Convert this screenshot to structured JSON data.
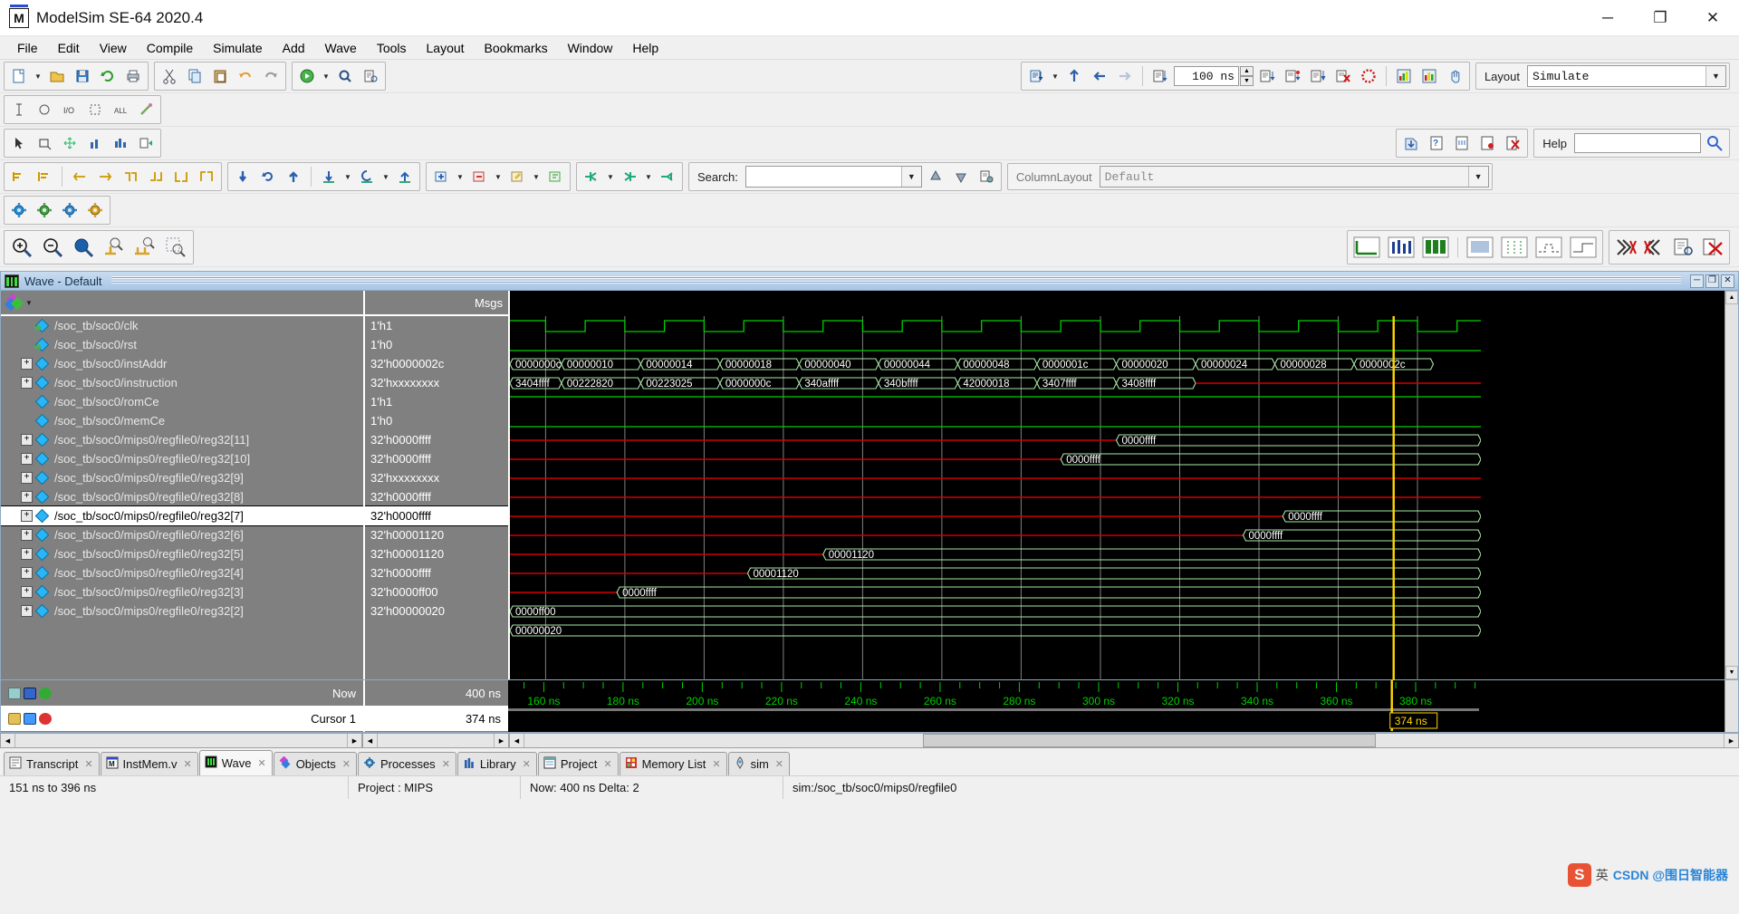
{
  "window": {
    "title": "ModelSim SE-64 2020.4",
    "icon": "modelsim-icon",
    "minimize": "─",
    "maximize": "❐",
    "close": "✕"
  },
  "menu": [
    "File",
    "Edit",
    "View",
    "Compile",
    "Simulate",
    "Add",
    "Wave",
    "Tools",
    "Layout",
    "Bookmarks",
    "Window",
    "Help"
  ],
  "toolbar": {
    "run_length_value": "100 ns",
    "layout_label": "Layout",
    "layout_value": "Simulate",
    "help_label": "Help",
    "help_value": "",
    "search_label": "Search:",
    "search_value": "",
    "search_placeholder": "",
    "columnlayout_label": "ColumnLayout",
    "columnlayout_value": "Default"
  },
  "wave_window": {
    "title": "Wave - Default",
    "minimize": "─",
    "restore": "❐",
    "close": "✕",
    "values_header": "Msgs"
  },
  "signals": [
    {
      "name": "/soc_tb/soc0/clk",
      "value": "1'h1",
      "expandable": false,
      "selected": false,
      "type": "input"
    },
    {
      "name": "/soc_tb/soc0/rst",
      "value": "1'h0",
      "expandable": false,
      "selected": false,
      "type": "input"
    },
    {
      "name": "/soc_tb/soc0/instAddr",
      "value": "32'h0000002c",
      "expandable": true,
      "selected": false,
      "type": "bus"
    },
    {
      "name": "/soc_tb/soc0/instruction",
      "value": "32'hxxxxxxxx",
      "expandable": true,
      "selected": false,
      "type": "bus"
    },
    {
      "name": "/soc_tb/soc0/romCe",
      "value": "1'h1",
      "expandable": false,
      "selected": false,
      "type": "wire"
    },
    {
      "name": "/soc_tb/soc0/memCe",
      "value": "1'h0",
      "expandable": false,
      "selected": false,
      "type": "wire"
    },
    {
      "name": "/soc_tb/soc0/mips0/regfile0/reg32[11]",
      "value": "32'h0000ffff",
      "expandable": true,
      "selected": false,
      "type": "bus"
    },
    {
      "name": "/soc_tb/soc0/mips0/regfile0/reg32[10]",
      "value": "32'h0000ffff",
      "expandable": true,
      "selected": false,
      "type": "bus"
    },
    {
      "name": "/soc_tb/soc0/mips0/regfile0/reg32[9]",
      "value": "32'hxxxxxxxx",
      "expandable": true,
      "selected": false,
      "type": "bus"
    },
    {
      "name": "/soc_tb/soc0/mips0/regfile0/reg32[8]",
      "value": "32'h0000ffff",
      "expandable": true,
      "selected": false,
      "type": "bus"
    },
    {
      "name": "/soc_tb/soc0/mips0/regfile0/reg32[7]",
      "value": "32'h0000ffff",
      "expandable": true,
      "selected": true,
      "type": "bus"
    },
    {
      "name": "/soc_tb/soc0/mips0/regfile0/reg32[6]",
      "value": "32'h00001120",
      "expandable": true,
      "selected": false,
      "type": "bus"
    },
    {
      "name": "/soc_tb/soc0/mips0/regfile0/reg32[5]",
      "value": "32'h00001120",
      "expandable": true,
      "selected": false,
      "type": "bus"
    },
    {
      "name": "/soc_tb/soc0/mips0/regfile0/reg32[4]",
      "value": "32'h0000ffff",
      "expandable": true,
      "selected": false,
      "type": "bus"
    },
    {
      "name": "/soc_tb/soc0/mips0/regfile0/reg32[3]",
      "value": "32'h0000ff00",
      "expandable": true,
      "selected": false,
      "type": "bus"
    },
    {
      "name": "/soc_tb/soc0/mips0/regfile0/reg32[2]",
      "value": "32'h00000020",
      "expandable": true,
      "selected": false,
      "type": "bus"
    }
  ],
  "cursor_panel": {
    "now_label": "Now",
    "now_value": "400 ns",
    "cursor_label": "Cursor 1",
    "cursor_value": "374 ns",
    "cursor_marker": "374 ns"
  },
  "tabs": [
    {
      "label": "Transcript",
      "icon": "transcript-icon",
      "active": false
    },
    {
      "label": "InstMem.v",
      "icon": "verilog-file-icon",
      "active": false
    },
    {
      "label": "Wave",
      "icon": "wave-icon",
      "active": true
    },
    {
      "label": "Objects",
      "icon": "objects-icon",
      "active": false
    },
    {
      "label": "Processes",
      "icon": "processes-icon",
      "active": false
    },
    {
      "label": "Library",
      "icon": "library-icon",
      "active": false
    },
    {
      "label": "Project",
      "icon": "project-icon",
      "active": false
    },
    {
      "label": "Memory List",
      "icon": "memory-icon",
      "active": false
    },
    {
      "label": "sim",
      "icon": "sim-icon",
      "active": false
    }
  ],
  "statusbar": {
    "range": "151 ns to 396 ns",
    "project": "Project : MIPS",
    "now": "Now: 400 ns  Delta: 2",
    "context": "sim:/soc_tb/soc0/mips0/regfile0"
  },
  "watermark": {
    "logo": "S",
    "text_cn": "英",
    "text_main": "CSDN @围日智能器"
  },
  "chart_data": {
    "type": "timing",
    "title": "Wave - Default",
    "time_unit": "ns",
    "visible_range": [
      151,
      396
    ],
    "axis_ticks": [
      "160 ns",
      "180 ns",
      "200 ns",
      "220 ns",
      "240 ns",
      "260 ns",
      "280 ns",
      "300 ns",
      "320 ns",
      "340 ns",
      "360 ns",
      "380 ns"
    ],
    "axis_tick_times": [
      160,
      180,
      200,
      220,
      240,
      260,
      280,
      300,
      320,
      340,
      360,
      380
    ],
    "cursor_time": 374,
    "now_time": 400,
    "clock_period": 20,
    "clock_start": 150,
    "colors": {
      "high": "#00d000",
      "undefined": "#d00000",
      "bus_edge": "#a8e8a8",
      "background": "#000000",
      "cursor": "#ffd800",
      "grid": "#808080",
      "axis_text": "#00d000"
    },
    "rows": [
      {
        "signal": "clk",
        "kind": "clock",
        "level": "1'h1"
      },
      {
        "signal": "rst",
        "kind": "const-low",
        "level": "1'h0"
      },
      {
        "signal": "instAddr",
        "kind": "bus",
        "segments": [
          {
            "start": 151,
            "end": 164,
            "value": "0000000c"
          },
          {
            "start": 164,
            "end": 184,
            "value": "00000010"
          },
          {
            "start": 184,
            "end": 204,
            "value": "00000014"
          },
          {
            "start": 204,
            "end": 224,
            "value": "00000018"
          },
          {
            "start": 224,
            "end": 244,
            "value": "00000040"
          },
          {
            "start": 244,
            "end": 264,
            "value": "00000044"
          },
          {
            "start": 264,
            "end": 284,
            "value": "00000048"
          },
          {
            "start": 284,
            "end": 304,
            "value": "0000001c"
          },
          {
            "start": 304,
            "end": 324,
            "value": "00000020"
          },
          {
            "start": 324,
            "end": 344,
            "value": "00000024"
          },
          {
            "start": 344,
            "end": 364,
            "value": "00000028"
          },
          {
            "start": 364,
            "end": 384,
            "value": "0000002c"
          }
        ]
      },
      {
        "signal": "instruction",
        "kind": "bus",
        "segments": [
          {
            "start": 151,
            "end": 164,
            "value": "3404ffff"
          },
          {
            "start": 164,
            "end": 184,
            "value": "00222820"
          },
          {
            "start": 184,
            "end": 204,
            "value": "00223025"
          },
          {
            "start": 204,
            "end": 224,
            "value": "0000000c"
          },
          {
            "start": 224,
            "end": 244,
            "value": "340affff"
          },
          {
            "start": 244,
            "end": 264,
            "value": "340bffff"
          },
          {
            "start": 264,
            "end": 284,
            "value": "42000018"
          },
          {
            "start": 284,
            "end": 304,
            "value": "3407ffff"
          },
          {
            "start": 304,
            "end": 324,
            "value": "3408ffff"
          },
          {
            "start": 324,
            "end": 396,
            "value": "xxxxxxxx"
          }
        ]
      },
      {
        "signal": "romCe",
        "kind": "const-high",
        "level": "1'h1"
      },
      {
        "signal": "memCe",
        "kind": "const-low",
        "level": "1'h0"
      },
      {
        "signal": "reg32[11]",
        "kind": "bus",
        "segments": [
          {
            "start": 151,
            "end": 304,
            "value": "x"
          },
          {
            "start": 304,
            "end": 396,
            "value": "0000ffff"
          }
        ]
      },
      {
        "signal": "reg32[10]",
        "kind": "bus",
        "segments": [
          {
            "start": 151,
            "end": 290,
            "value": "x"
          },
          {
            "start": 290,
            "end": 396,
            "value": "0000ffff"
          }
        ]
      },
      {
        "signal": "reg32[9]",
        "kind": "bus",
        "segments": [
          {
            "start": 151,
            "end": 396,
            "value": "x"
          }
        ]
      },
      {
        "signal": "reg32[8]",
        "kind": "bus",
        "segments": [
          {
            "start": 151,
            "end": 396,
            "value": "x"
          }
        ]
      },
      {
        "signal": "reg32[7]",
        "kind": "bus",
        "segments": [
          {
            "start": 151,
            "end": 346,
            "value": "x"
          },
          {
            "start": 346,
            "end": 396,
            "value": "0000ffff"
          }
        ]
      },
      {
        "signal": "reg32[6]",
        "kind": "bus",
        "segments": [
          {
            "start": 151,
            "end": 336,
            "value": "x"
          },
          {
            "start": 336,
            "end": 396,
            "value": "0000ffff"
          }
        ]
      },
      {
        "signal": "reg32[5]",
        "kind": "bus",
        "segments": [
          {
            "start": 151,
            "end": 230,
            "value": "x"
          },
          {
            "start": 230,
            "end": 396,
            "value": "00001120"
          }
        ]
      },
      {
        "signal": "reg32[4]",
        "kind": "bus",
        "segments": [
          {
            "start": 151,
            "end": 211,
            "value": "x"
          },
          {
            "start": 211,
            "end": 396,
            "value": "00001120"
          }
        ]
      },
      {
        "signal": "reg32[3]",
        "kind": "bus",
        "segments": [
          {
            "start": 151,
            "end": 178,
            "value": "x"
          },
          {
            "start": 178,
            "end": 396,
            "value": "0000ffff"
          }
        ]
      },
      {
        "signal": "reg32[2]",
        "kind": "bus",
        "segments": [
          {
            "start": 151,
            "end": 396,
            "value": "0000ff00"
          }
        ]
      },
      {
        "signal": "reg32[1]",
        "kind": "bus",
        "segments": [
          {
            "start": 151,
            "end": 396,
            "value": "00000020"
          }
        ]
      }
    ]
  }
}
